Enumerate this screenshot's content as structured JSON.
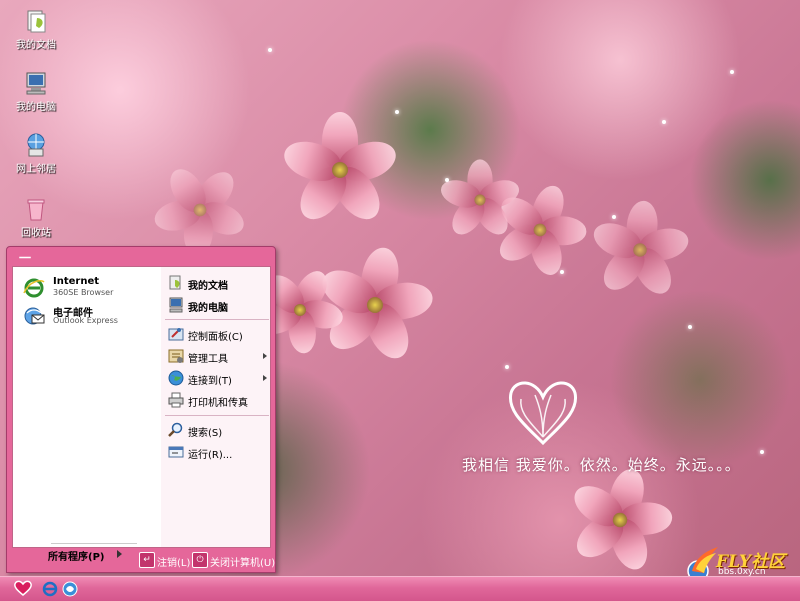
{
  "desktop": {
    "icons": [
      {
        "label": "我的文档",
        "icon": "my-documents-icon"
      },
      {
        "label": "我的电脑",
        "icon": "my-computer-icon"
      },
      {
        "label": "网上邻居",
        "icon": "network-places-icon"
      },
      {
        "label": "回收站",
        "icon": "recycle-bin-icon"
      }
    ],
    "slogan": "我相信 我爱你。依然。始终。永远。。。",
    "watermark": {
      "brand": "FLY社区",
      "site": "bbs.0xy.cn"
    }
  },
  "start_menu": {
    "user_name": "一",
    "pinned": [
      {
        "title": "Internet",
        "subtitle": "360SE Browser",
        "icon": "ie-icon"
      },
      {
        "title": "电子邮件",
        "subtitle": "Outlook Express",
        "icon": "outlook-icon"
      }
    ],
    "all_programs": "所有程序(P)",
    "right_items": [
      {
        "label": "我的文档",
        "bold": true
      },
      {
        "label": "我的电脑",
        "bold": true
      },
      {
        "label": "控制面板(C)"
      },
      {
        "label": "管理工具",
        "submenu": true
      },
      {
        "label": "连接到(T)",
        "submenu": true
      },
      {
        "label": "打印机和传真"
      },
      {
        "label": "搜索(S)"
      },
      {
        "label": "运行(R)..."
      }
    ],
    "logoff": "注销(L)",
    "shutdown": "关闭计算机(U)"
  },
  "colors": {
    "menu_frame": "#e5679a",
    "taskbar": "#e0679a"
  }
}
